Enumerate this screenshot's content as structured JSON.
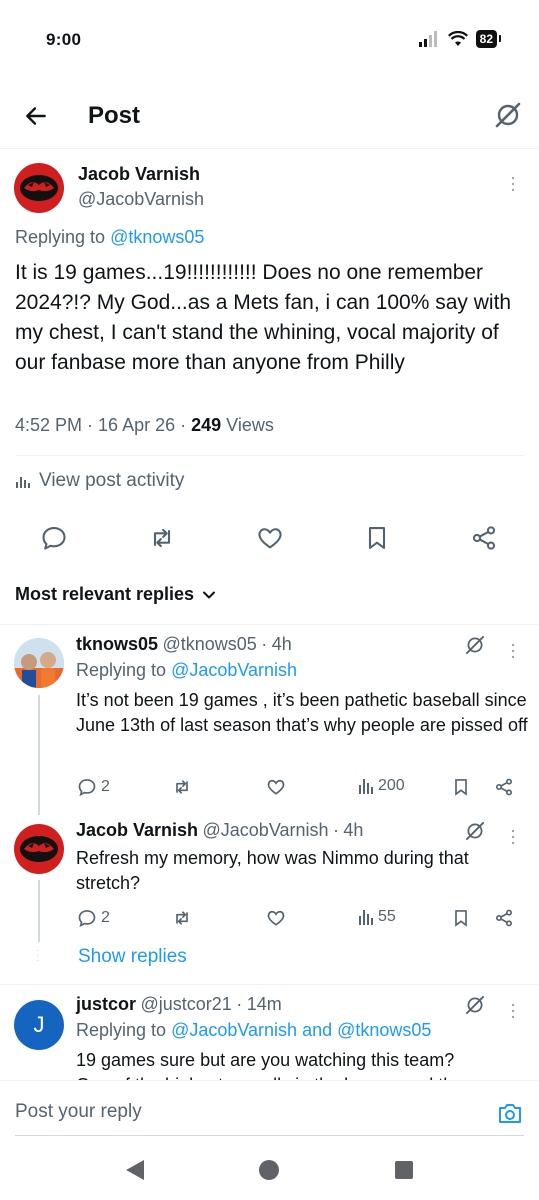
{
  "status_bar": {
    "time": "9:00",
    "battery": "82"
  },
  "header": {
    "title": "Post"
  },
  "main_post": {
    "author_name": "Jacob Varnish",
    "author_handle": "@JacobVarnish",
    "replying_label": "Replying to ",
    "replying_to": "@tknows05",
    "text": "It is 19 games...19!!!!!!!!!!!!  Does no one remember 2024?!?  My God...as a Mets fan, i can 100% say with my chest, I can't stand the whining, vocal majority of our fanbase more than anyone from Philly",
    "time": "4:52 PM",
    "date": "16 Apr 26",
    "views_count": "249",
    "views_label": "Views",
    "activity_label": "View post activity"
  },
  "sort": {
    "label": "Most relevant replies"
  },
  "replies": [
    {
      "name": "tknows05",
      "handle": "@tknows05",
      "age": "4h",
      "replying_label": "Replying to ",
      "replying_to": "@JacobVarnish",
      "text": "It’s not been 19 games , it’s been pathetic baseball since June 13th of last season that’s why people are pissed off",
      "reply_count": "2",
      "views": "200"
    },
    {
      "name": "Jacob Varnish",
      "handle": "@JacobVarnish",
      "age": "4h",
      "text": "Refresh my memory, how was Nimmo during that stretch?",
      "reply_count": "2",
      "views": "55"
    },
    {
      "name": "justcor",
      "handle": "@justcor21",
      "age": "14m",
      "avatar_letter": "J",
      "replying_label": "Replying to ",
      "replying_to": "@JacobVarnish and @tknows05",
      "text": "19 games sure but are you watching this team?",
      "text_cut": "One of the highest payrolls in the league and the"
    }
  ],
  "show_replies": "Show replies",
  "composer": {
    "placeholder": "Post your reply"
  },
  "colors": {
    "accent": "#1d9bf0",
    "text": "#0f1419",
    "muted": "#536471",
    "divider": "#eff3f4",
    "avatar_red": "#d11f1f",
    "avatar_blue": "#1565c0"
  }
}
